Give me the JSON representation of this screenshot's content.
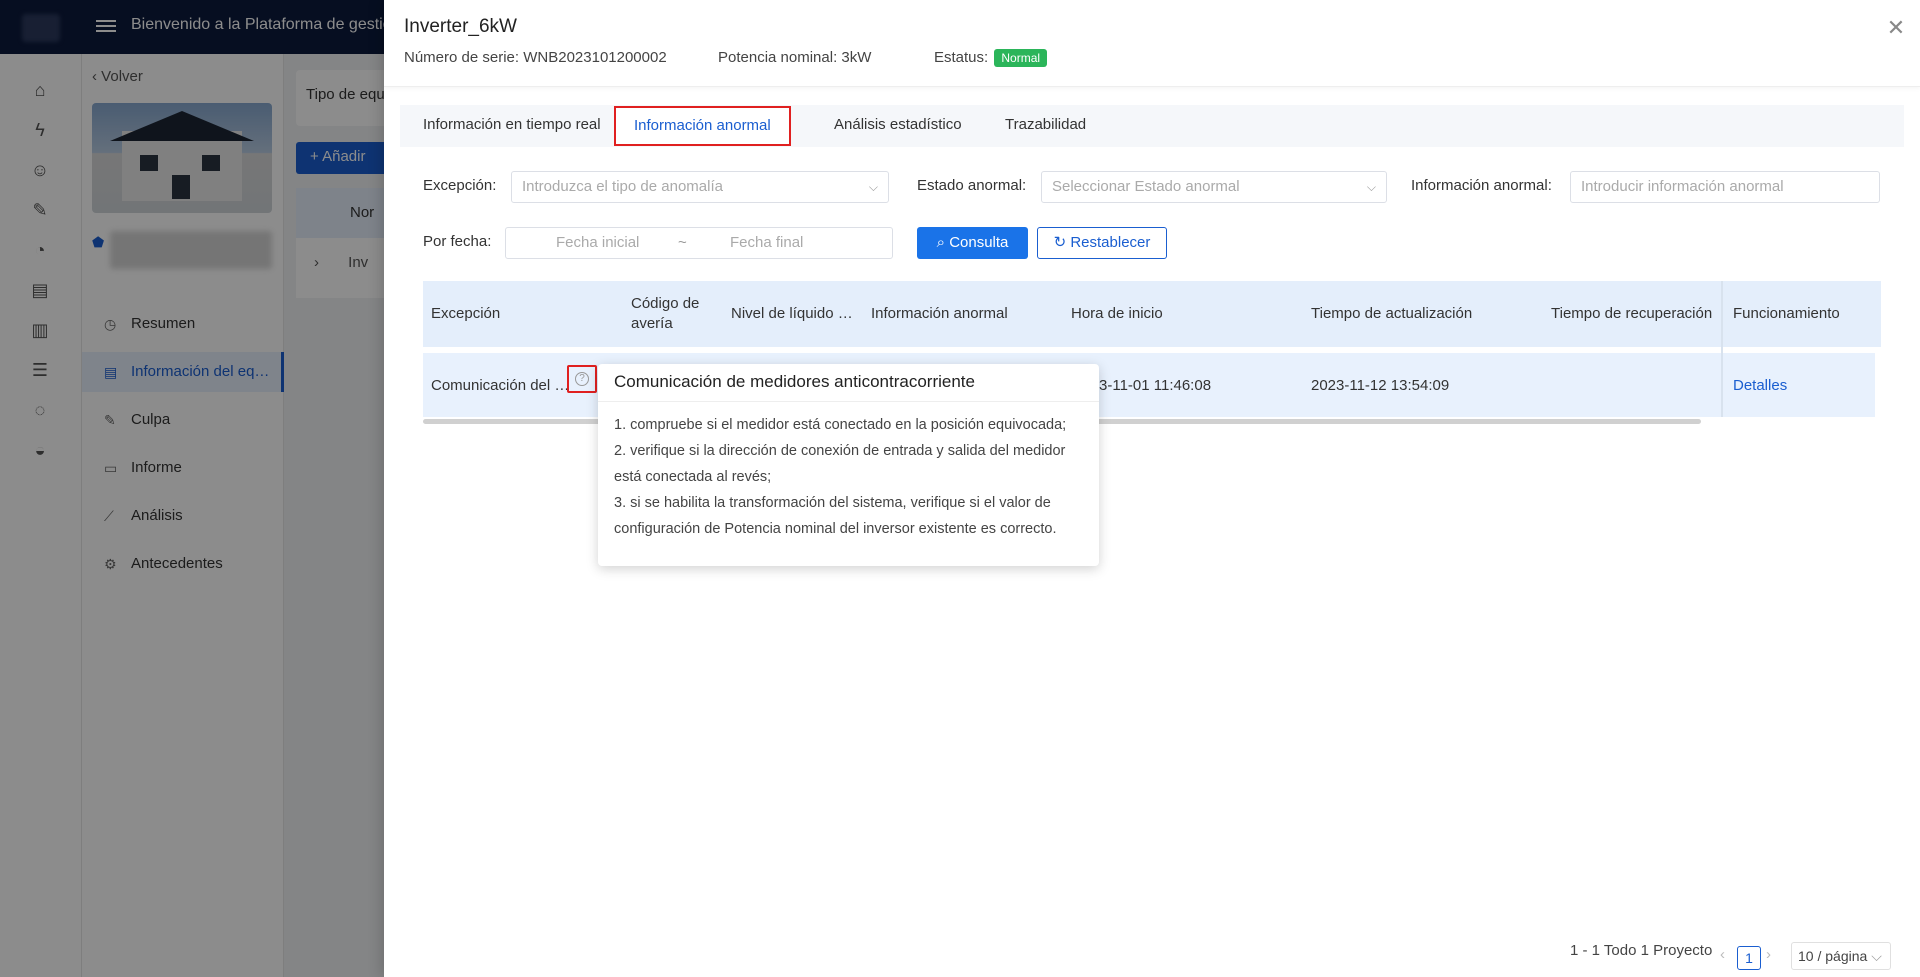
{
  "app": {
    "title": "Bienvenido a la Plataforma de gestión d"
  },
  "subnav": {
    "back_label": "Volver",
    "items": [
      {
        "label": "Resumen",
        "icon": "gauge-icon"
      },
      {
        "label": "Información del eq…",
        "icon": "list-icon"
      },
      {
        "label": "Culpa",
        "icon": "wrench-icon"
      },
      {
        "label": "Informe",
        "icon": "report-icon"
      },
      {
        "label": "Análisis",
        "icon": "chart-icon"
      },
      {
        "label": "Antecedentes",
        "icon": "gear-icon"
      }
    ]
  },
  "bg_main": {
    "filter_label": "Tipo de equ",
    "add_button": "Añadir",
    "table_header": "Nor",
    "row_text": "Inv"
  },
  "drawer": {
    "title": "Inverter_6kW",
    "serial_label": "Número de serie:",
    "serial_value": "WNB2023101200002",
    "power_label": "Potencia nominal:",
    "power_value": "3kW",
    "status_label": "Estatus:",
    "status_value": "Normal",
    "status_color": "#2bb55a"
  },
  "tabs": [
    {
      "label": "Información en tiempo real"
    },
    {
      "label": "Información anormal"
    },
    {
      "label": "Análisis estadístico"
    },
    {
      "label": "Trazabilidad"
    }
  ],
  "filters": {
    "exception_label": "Excepción:",
    "exception_placeholder": "Introduzca el tipo de anomalía",
    "state_label": "Estado anormal:",
    "state_placeholder": "Seleccionar Estado anormal",
    "info_label": "Información anormal:",
    "info_placeholder": "Introducir información anormal",
    "date_label": "Por fecha:",
    "date_start_placeholder": "Fecha inicial",
    "date_separator": "~",
    "date_end_placeholder": "Fecha final",
    "query_button": "Consulta",
    "reset_button": "Restablecer"
  },
  "table": {
    "columns": [
      "Excepción",
      "Código de avería",
      "Nivel de líquido …",
      "Información anormal",
      "Hora de inicio",
      "Tiempo de actualización",
      "Tiempo de recuperación",
      "Funcionamiento"
    ],
    "rows": [
      {
        "exception": "Comunicación del …",
        "start_time": "3-11-01 11:46:08",
        "update_time": "2023-11-12 13:54:09",
        "action": "Detalles"
      }
    ]
  },
  "popover": {
    "title": "Comunicación de medidores anticontracorriente",
    "lines": [
      "1. compruebe si el medidor está conectado en la posición equivocada;",
      "2. verifique si la dirección de conexión de entrada y salida del medidor está conectada al revés;",
      "3. si se habilita la transformación del sistema, verifique si el valor de configuración de Potencia nominal del inversor existente es correcto."
    ]
  },
  "pagination": {
    "summary": "1 - 1 Todo 1 Proyecto",
    "current_page": "1",
    "page_size": "10 / página"
  }
}
